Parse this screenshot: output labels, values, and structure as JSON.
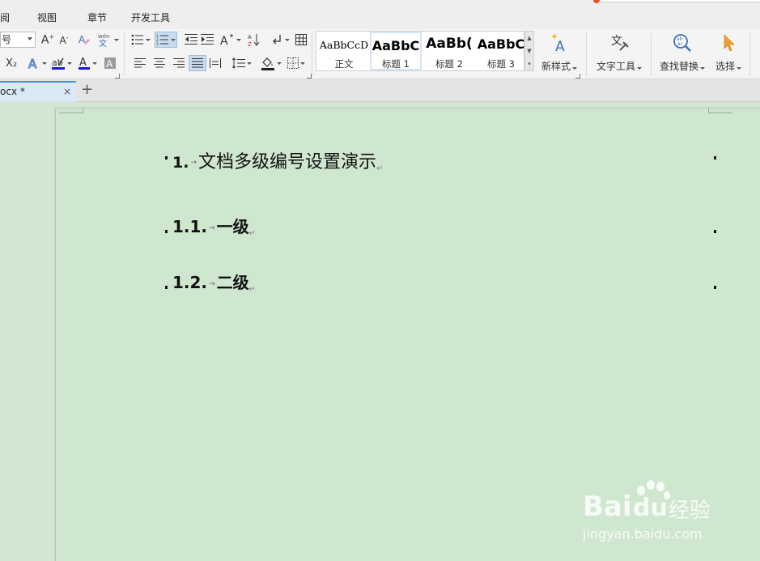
{
  "menu": {
    "items": [
      "阅",
      "视图",
      "章节",
      "开发工具"
    ]
  },
  "ribbon": {
    "font_size_value": "号",
    "subscript": "X₂",
    "pinyin": "wén\n文",
    "styles": [
      {
        "sample": "AaBbCcD",
        "label": "正文"
      },
      {
        "sample": "AaBbC",
        "label": "标题 1"
      },
      {
        "sample": "AaBb(",
        "label": "标题 2"
      },
      {
        "sample": "AaBbC",
        "label": "标题 3"
      }
    ],
    "new_style_label": "新样式",
    "text_tools_label": "文字工具",
    "find_replace_label": "查找替换",
    "select_label": "选择",
    "accent_color": "#e8501e",
    "select_icon_color": "#f0a030"
  },
  "tabs": {
    "doc_tab_label": "ocx *",
    "close": "×",
    "new": "+"
  },
  "document": {
    "h1_num": "1.",
    "h1_text": "文档多级编号设置演示",
    "h2a_num": "1.1.",
    "h2a_text": "一级",
    "h2b_num": "1.2.",
    "h2b_text": "二级",
    "tab_mark": "→",
    "para_mark": "↵",
    "page_bg": "#cfe7cf"
  },
  "watermark": {
    "brand": "Bai",
    "brand2": "du",
    "brand_cn": "经验",
    "url": "jingyan.baidu.com"
  }
}
